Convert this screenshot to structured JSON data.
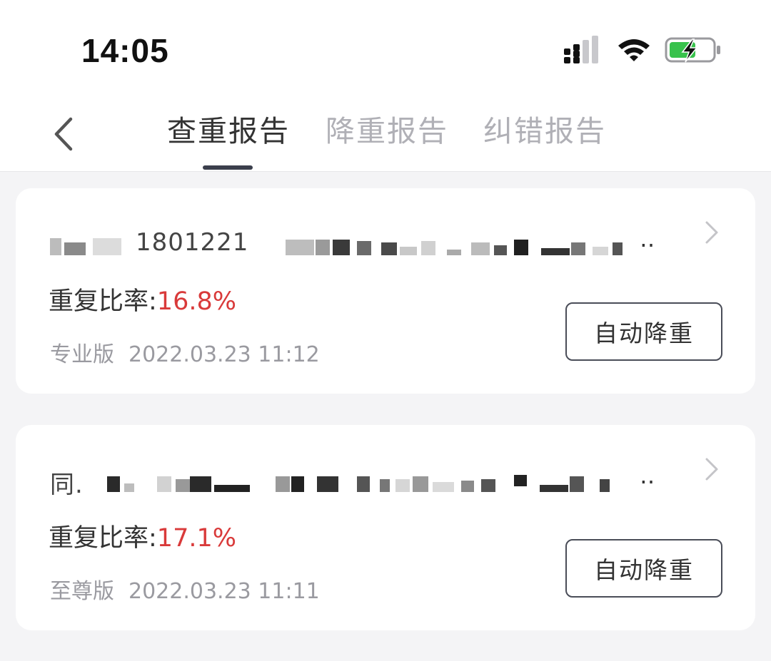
{
  "status_bar": {
    "time": "14:05"
  },
  "nav": {
    "tabs": [
      {
        "label": "查重报告",
        "active": true
      },
      {
        "label": "降重报告",
        "active": false
      },
      {
        "label": "纠错报告",
        "active": false
      }
    ]
  },
  "reports": [
    {
      "title_visible": "1801221",
      "ellipsis": "…",
      "rate_label": "重复比率:",
      "rate_value": "16.8%",
      "edition": "专业版",
      "datetime": "2022.03.23 11:12",
      "action_label": "自动降重"
    },
    {
      "title_visible": "同.",
      "ellipsis": "…",
      "rate_label": "重复比率:",
      "rate_value": "17.1%",
      "edition": "至尊版",
      "datetime": "2022.03.23 11:11",
      "action_label": "自动降重"
    }
  ],
  "colors": {
    "accent_red": "#d93a3a",
    "indicator": "#3b3f4c"
  },
  "icons": [
    "signal-icon",
    "wifi-icon",
    "battery-charging-icon",
    "back-chevron-icon",
    "chevron-right-icon"
  ]
}
